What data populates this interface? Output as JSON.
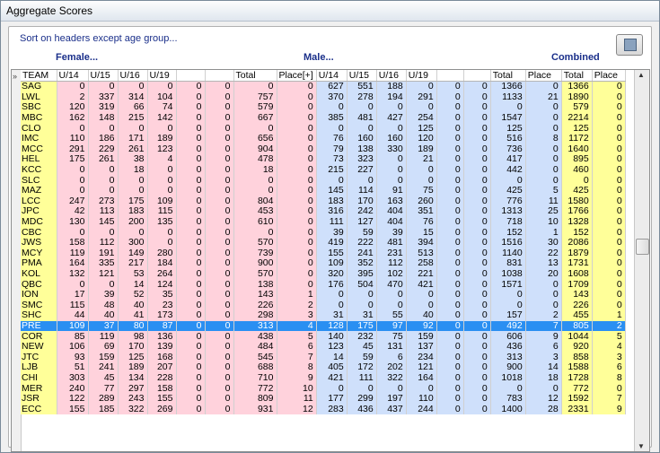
{
  "window": {
    "title": "Aggregate Scores"
  },
  "panel": {
    "hint": "Sort on headers except age group...",
    "groups": [
      "Female...",
      "Male...",
      "Combined"
    ]
  },
  "colors": {
    "yellow": "#ffff99",
    "pink": "#ffd2dc",
    "blue": "#cfe0fb",
    "selected": "#2a8ff2"
  },
  "icons": {
    "print_button": "print-icon",
    "row_pointer": "chevron-right-icon"
  },
  "table": {
    "columns": [
      "TEAM",
      "U/14",
      "U/15",
      "U/16",
      "U/19",
      "",
      "",
      "Total",
      "Place[+]",
      "U/14",
      "U/15",
      "U/16",
      "U/19",
      "",
      "",
      "Total",
      "Place",
      "Total",
      "Place"
    ],
    "selected_row": 23,
    "rows": [
      [
        "SAG",
        "0",
        "0",
        "0",
        "0",
        "0",
        "0",
        "0",
        "0",
        "627",
        "551",
        "188",
        "0",
        "0",
        "0",
        "1366",
        "0",
        "1366",
        "0"
      ],
      [
        "LWL",
        "2",
        "337",
        "314",
        "104",
        "0",
        "0",
        "757",
        "0",
        "370",
        "278",
        "194",
        "291",
        "0",
        "0",
        "1133",
        "21",
        "1890",
        "0"
      ],
      [
        "SBC",
        "120",
        "319",
        "66",
        "74",
        "0",
        "0",
        "579",
        "0",
        "0",
        "0",
        "0",
        "0",
        "0",
        "0",
        "0",
        "0",
        "579",
        "0"
      ],
      [
        "MBC",
        "162",
        "148",
        "215",
        "142",
        "0",
        "0",
        "667",
        "0",
        "385",
        "481",
        "427",
        "254",
        "0",
        "0",
        "1547",
        "0",
        "2214",
        "0"
      ],
      [
        "CLO",
        "0",
        "0",
        "0",
        "0",
        "0",
        "0",
        "0",
        "0",
        "0",
        "0",
        "0",
        "125",
        "0",
        "0",
        "125",
        "0",
        "125",
        "0"
      ],
      [
        "IMC",
        "110",
        "186",
        "171",
        "189",
        "0",
        "0",
        "656",
        "0",
        "76",
        "160",
        "160",
        "120",
        "0",
        "0",
        "516",
        "8",
        "1172",
        "0"
      ],
      [
        "MCC",
        "291",
        "229",
        "261",
        "123",
        "0",
        "0",
        "904",
        "0",
        "79",
        "138",
        "330",
        "189",
        "0",
        "0",
        "736",
        "0",
        "1640",
        "0"
      ],
      [
        "HEL",
        "175",
        "261",
        "38",
        "4",
        "0",
        "0",
        "478",
        "0",
        "73",
        "323",
        "0",
        "21",
        "0",
        "0",
        "417",
        "0",
        "895",
        "0"
      ],
      [
        "KCC",
        "0",
        "0",
        "18",
        "0",
        "0",
        "0",
        "18",
        "0",
        "215",
        "227",
        "0",
        "0",
        "0",
        "0",
        "442",
        "0",
        "460",
        "0"
      ],
      [
        "SLC",
        "0",
        "0",
        "0",
        "0",
        "0",
        "0",
        "0",
        "0",
        "0",
        "0",
        "0",
        "0",
        "0",
        "0",
        "0",
        "0",
        "0",
        "0"
      ],
      [
        "MAZ",
        "0",
        "0",
        "0",
        "0",
        "0",
        "0",
        "0",
        "0",
        "145",
        "114",
        "91",
        "75",
        "0",
        "0",
        "425",
        "5",
        "425",
        "0"
      ],
      [
        "LCC",
        "247",
        "273",
        "175",
        "109",
        "0",
        "0",
        "804",
        "0",
        "183",
        "170",
        "163",
        "260",
        "0",
        "0",
        "776",
        "11",
        "1580",
        "0"
      ],
      [
        "JPC",
        "42",
        "113",
        "183",
        "115",
        "0",
        "0",
        "453",
        "0",
        "316",
        "242",
        "404",
        "351",
        "0",
        "0",
        "1313",
        "25",
        "1766",
        "0"
      ],
      [
        "MDC",
        "130",
        "145",
        "200",
        "135",
        "0",
        "0",
        "610",
        "0",
        "111",
        "127",
        "404",
        "76",
        "0",
        "0",
        "718",
        "10",
        "1328",
        "0"
      ],
      [
        "CBC",
        "0",
        "0",
        "0",
        "0",
        "0",
        "0",
        "0",
        "0",
        "39",
        "59",
        "39",
        "15",
        "0",
        "0",
        "152",
        "1",
        "152",
        "0"
      ],
      [
        "JWS",
        "158",
        "112",
        "300",
        "0",
        "0",
        "0",
        "570",
        "0",
        "419",
        "222",
        "481",
        "394",
        "0",
        "0",
        "1516",
        "30",
        "2086",
        "0"
      ],
      [
        "MCY",
        "119",
        "191",
        "149",
        "280",
        "0",
        "0",
        "739",
        "0",
        "155",
        "241",
        "231",
        "513",
        "0",
        "0",
        "1140",
        "22",
        "1879",
        "0"
      ],
      [
        "PMA",
        "164",
        "335",
        "217",
        "184",
        "0",
        "0",
        "900",
        "0",
        "109",
        "352",
        "112",
        "258",
        "0",
        "0",
        "831",
        "13",
        "1731",
        "0"
      ],
      [
        "KOL",
        "132",
        "121",
        "53",
        "264",
        "0",
        "0",
        "570",
        "0",
        "320",
        "395",
        "102",
        "221",
        "0",
        "0",
        "1038",
        "20",
        "1608",
        "0"
      ],
      [
        "QBC",
        "0",
        "0",
        "14",
        "124",
        "0",
        "0",
        "138",
        "0",
        "176",
        "504",
        "470",
        "421",
        "0",
        "0",
        "1571",
        "0",
        "1709",
        "0"
      ],
      [
        "ION",
        "17",
        "39",
        "52",
        "35",
        "0",
        "0",
        "143",
        "1",
        "0",
        "0",
        "0",
        "0",
        "0",
        "0",
        "0",
        "0",
        "143",
        "0"
      ],
      [
        "SMC",
        "115",
        "48",
        "40",
        "23",
        "0",
        "0",
        "226",
        "2",
        "0",
        "0",
        "0",
        "0",
        "0",
        "0",
        "0",
        "0",
        "226",
        "0"
      ],
      [
        "SHC",
        "44",
        "40",
        "41",
        "173",
        "0",
        "0",
        "298",
        "3",
        "31",
        "31",
        "55",
        "40",
        "0",
        "0",
        "157",
        "2",
        "455",
        "1"
      ],
      [
        "PRE",
        "109",
        "37",
        "80",
        "87",
        "0",
        "0",
        "313",
        "4",
        "128",
        "175",
        "97",
        "92",
        "0",
        "0",
        "492",
        "7",
        "805",
        "2"
      ],
      [
        "COR",
        "85",
        "119",
        "98",
        "136",
        "0",
        "0",
        "438",
        "5",
        "140",
        "232",
        "75",
        "159",
        "0",
        "0",
        "606",
        "9",
        "1044",
        "5"
      ],
      [
        "NEW",
        "106",
        "69",
        "170",
        "139",
        "0",
        "0",
        "484",
        "6",
        "123",
        "45",
        "131",
        "137",
        "0",
        "0",
        "436",
        "6",
        "920",
        "4"
      ],
      [
        "JTC",
        "93",
        "159",
        "125",
        "168",
        "0",
        "0",
        "545",
        "7",
        "14",
        "59",
        "6",
        "234",
        "0",
        "0",
        "313",
        "3",
        "858",
        "3"
      ],
      [
        "LJB",
        "51",
        "241",
        "189",
        "207",
        "0",
        "0",
        "688",
        "8",
        "405",
        "172",
        "202",
        "121",
        "0",
        "0",
        "900",
        "14",
        "1588",
        "6"
      ],
      [
        "CHI",
        "303",
        "45",
        "134",
        "228",
        "0",
        "0",
        "710",
        "9",
        "421",
        "111",
        "322",
        "164",
        "0",
        "0",
        "1018",
        "18",
        "1728",
        "8"
      ],
      [
        "MER",
        "240",
        "77",
        "297",
        "158",
        "0",
        "0",
        "772",
        "10",
        "0",
        "0",
        "0",
        "0",
        "0",
        "0",
        "0",
        "0",
        "772",
        "0"
      ],
      [
        "JSR",
        "122",
        "289",
        "243",
        "155",
        "0",
        "0",
        "809",
        "11",
        "177",
        "299",
        "197",
        "110",
        "0",
        "0",
        "783",
        "12",
        "1592",
        "7"
      ],
      [
        "ECC",
        "155",
        "185",
        "322",
        "269",
        "0",
        "0",
        "931",
        "12",
        "283",
        "436",
        "437",
        "244",
        "0",
        "0",
        "1400",
        "28",
        "2331",
        "9"
      ]
    ]
  }
}
